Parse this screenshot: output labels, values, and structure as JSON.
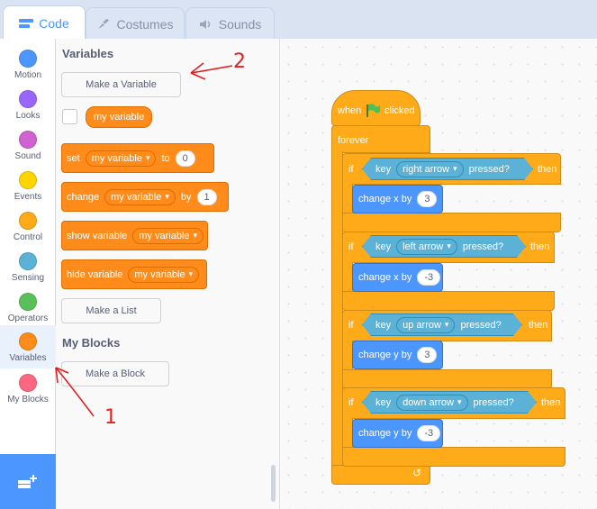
{
  "tabs": [
    {
      "label": "Code",
      "icon": "code-icon"
    },
    {
      "label": "Costumes",
      "icon": "brush-icon"
    },
    {
      "label": "Sounds",
      "icon": "speaker-icon"
    }
  ],
  "categories": [
    {
      "label": "Motion",
      "color": "#4c97ff"
    },
    {
      "label": "Looks",
      "color": "#9966ff"
    },
    {
      "label": "Sound",
      "color": "#cf63cf"
    },
    {
      "label": "Events",
      "color": "#ffd500"
    },
    {
      "label": "Control",
      "color": "#ffab19"
    },
    {
      "label": "Sensing",
      "color": "#5cb1d6"
    },
    {
      "label": "Operators",
      "color": "#59c059"
    },
    {
      "label": "Variables",
      "color": "#ff8c1a"
    },
    {
      "label": "My Blocks",
      "color": "#ff6680"
    }
  ],
  "palette": {
    "variables_heading": "Variables",
    "make_variable": "Make a Variable",
    "my_variable": "my variable",
    "set_block": {
      "label": "set",
      "var": "my variable",
      "to": "to",
      "value": "0"
    },
    "change_block": {
      "label": "change",
      "var": "my variable",
      "by": "by",
      "value": "1"
    },
    "show_block": {
      "label": "show variable",
      "var": "my variable"
    },
    "hide_block": {
      "label": "hide variable",
      "var": "my variable"
    },
    "make_list": "Make a List",
    "myblocks_heading": "My Blocks",
    "make_block": "Make a Block"
  },
  "script": {
    "hat": {
      "when": "when",
      "clicked": "clicked"
    },
    "forever": "forever",
    "if": "if",
    "then": "then",
    "key": "key",
    "pressed": "pressed?",
    "conditions": [
      {
        "key": "right arrow",
        "action": "change x by",
        "value": "3"
      },
      {
        "key": "left arrow",
        "action": "change x by",
        "value": "-3"
      },
      {
        "key": "up arrow",
        "action": "change y by",
        "value": "3"
      },
      {
        "key": "down arrow",
        "action": "change y by",
        "value": "-3"
      }
    ]
  },
  "annotations": {
    "one": "1",
    "two": "2"
  }
}
